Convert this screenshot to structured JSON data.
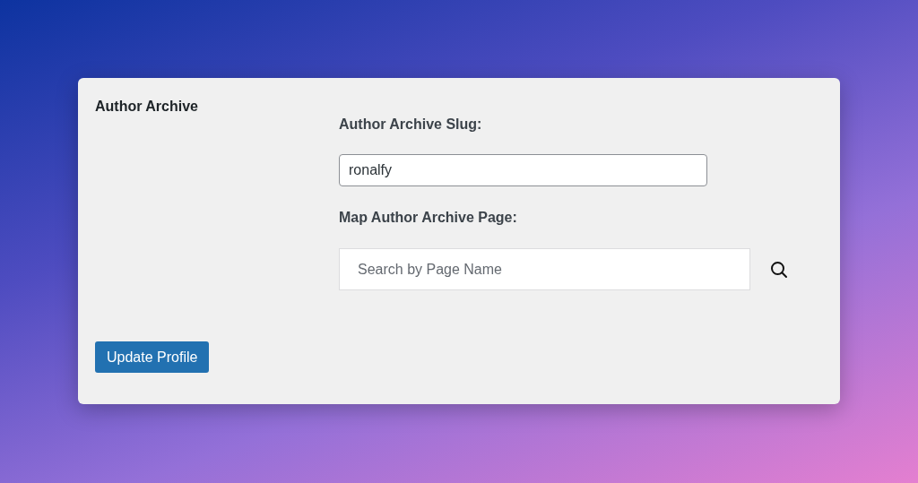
{
  "section": {
    "title": "Author Archive"
  },
  "slug": {
    "label": "Author Archive Slug:",
    "value": "ronalfy"
  },
  "page_map": {
    "label": "Map Author Archive Page:",
    "placeholder": "Search by Page Name"
  },
  "buttons": [
    {
      "label": "Update Profile"
    }
  ]
}
